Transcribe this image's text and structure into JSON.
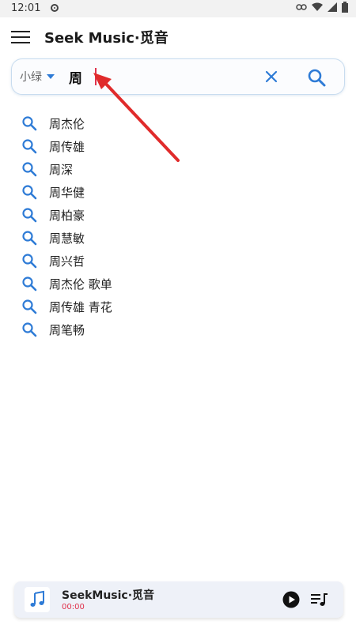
{
  "status_bar": {
    "time": "12:01"
  },
  "app_bar": {
    "title": "Seek Music·觅音"
  },
  "search": {
    "source": "小绿",
    "query": "周"
  },
  "suggestions": [
    "周杰伦",
    "周传雄",
    "周深",
    "周华健",
    "周柏豪",
    "周慧敏",
    "周兴哲",
    "周杰伦 歌单",
    "周传雄 青花",
    "周笔畅"
  ],
  "player": {
    "title": "SeekMusic·觅音",
    "time": "00:00"
  },
  "colors": {
    "accent": "#2e7bd6",
    "highlight": "#e0334d"
  },
  "icons": [
    "menu-icon",
    "caret-down-icon",
    "clear-icon",
    "search-icon",
    "music-note-icon",
    "play-icon",
    "playlist-icon"
  ]
}
